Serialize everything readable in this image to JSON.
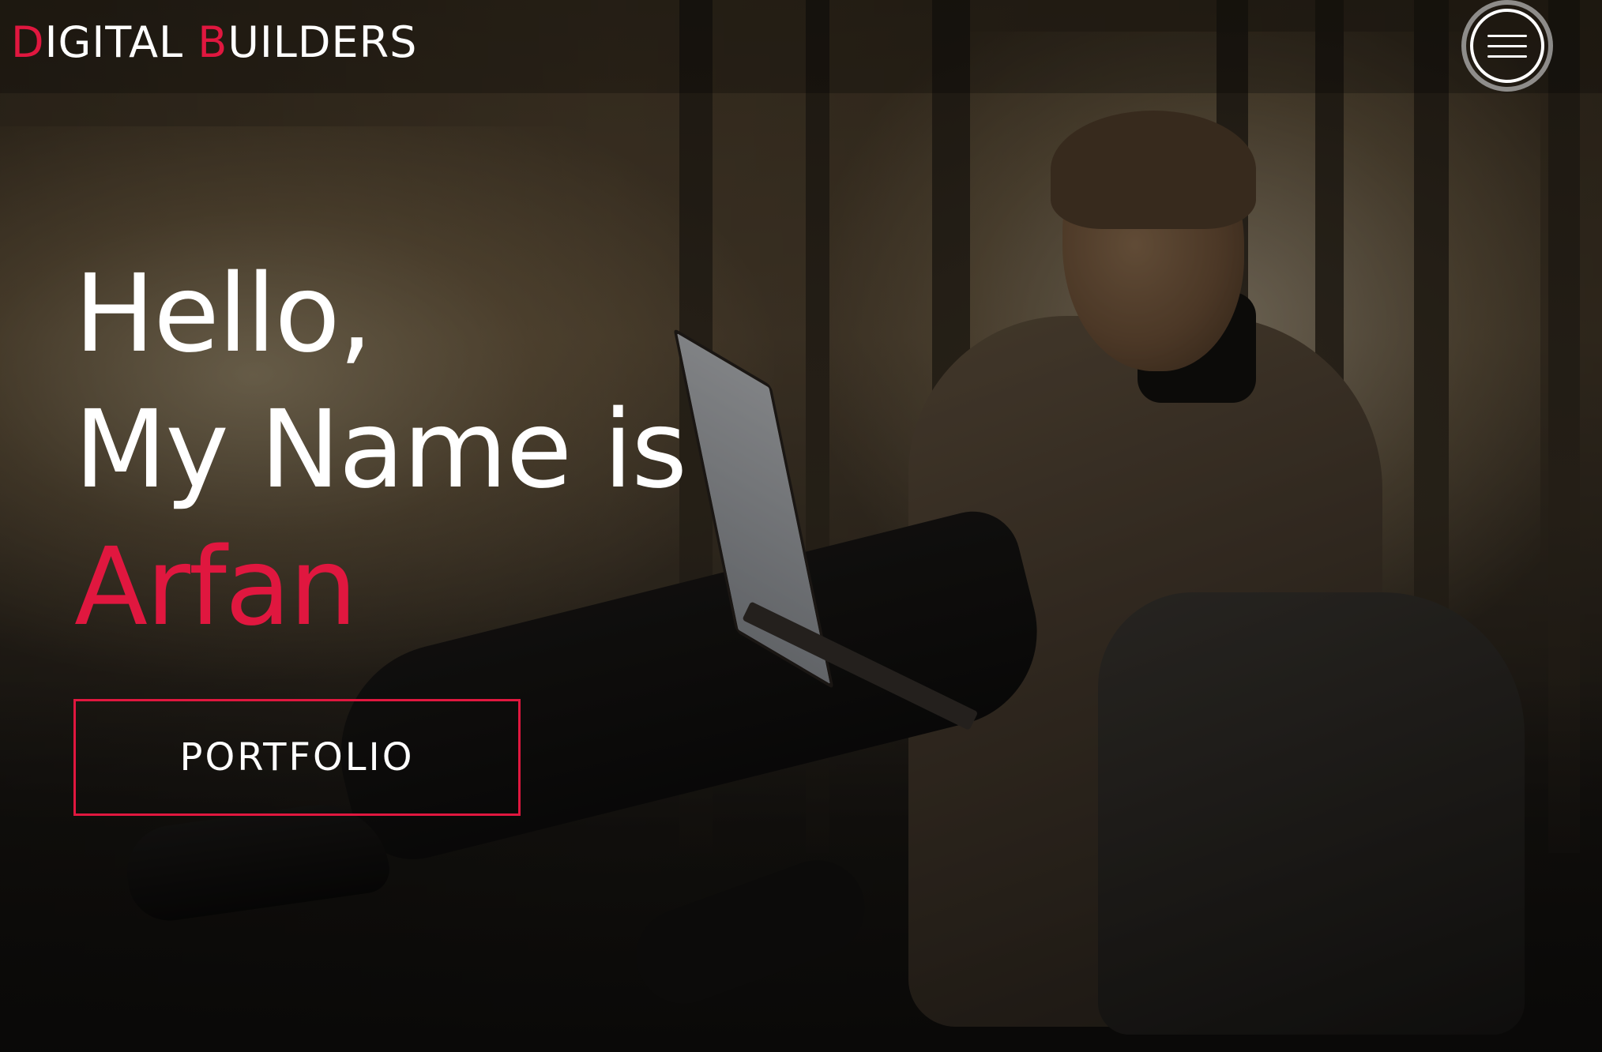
{
  "header": {
    "brand": {
      "word1_initial": "D",
      "word1_rest": "IGITAL",
      "word2_initial": "B",
      "word2_rest": "UILDERS"
    },
    "menu_icon": "hamburger-menu-icon"
  },
  "hero": {
    "line1": "Hello,",
    "line2": "My Name is",
    "name": "Arfan",
    "cta_label": "PORTFOLIO"
  },
  "colors": {
    "accent": "#e0173f",
    "text": "#ffffff"
  }
}
